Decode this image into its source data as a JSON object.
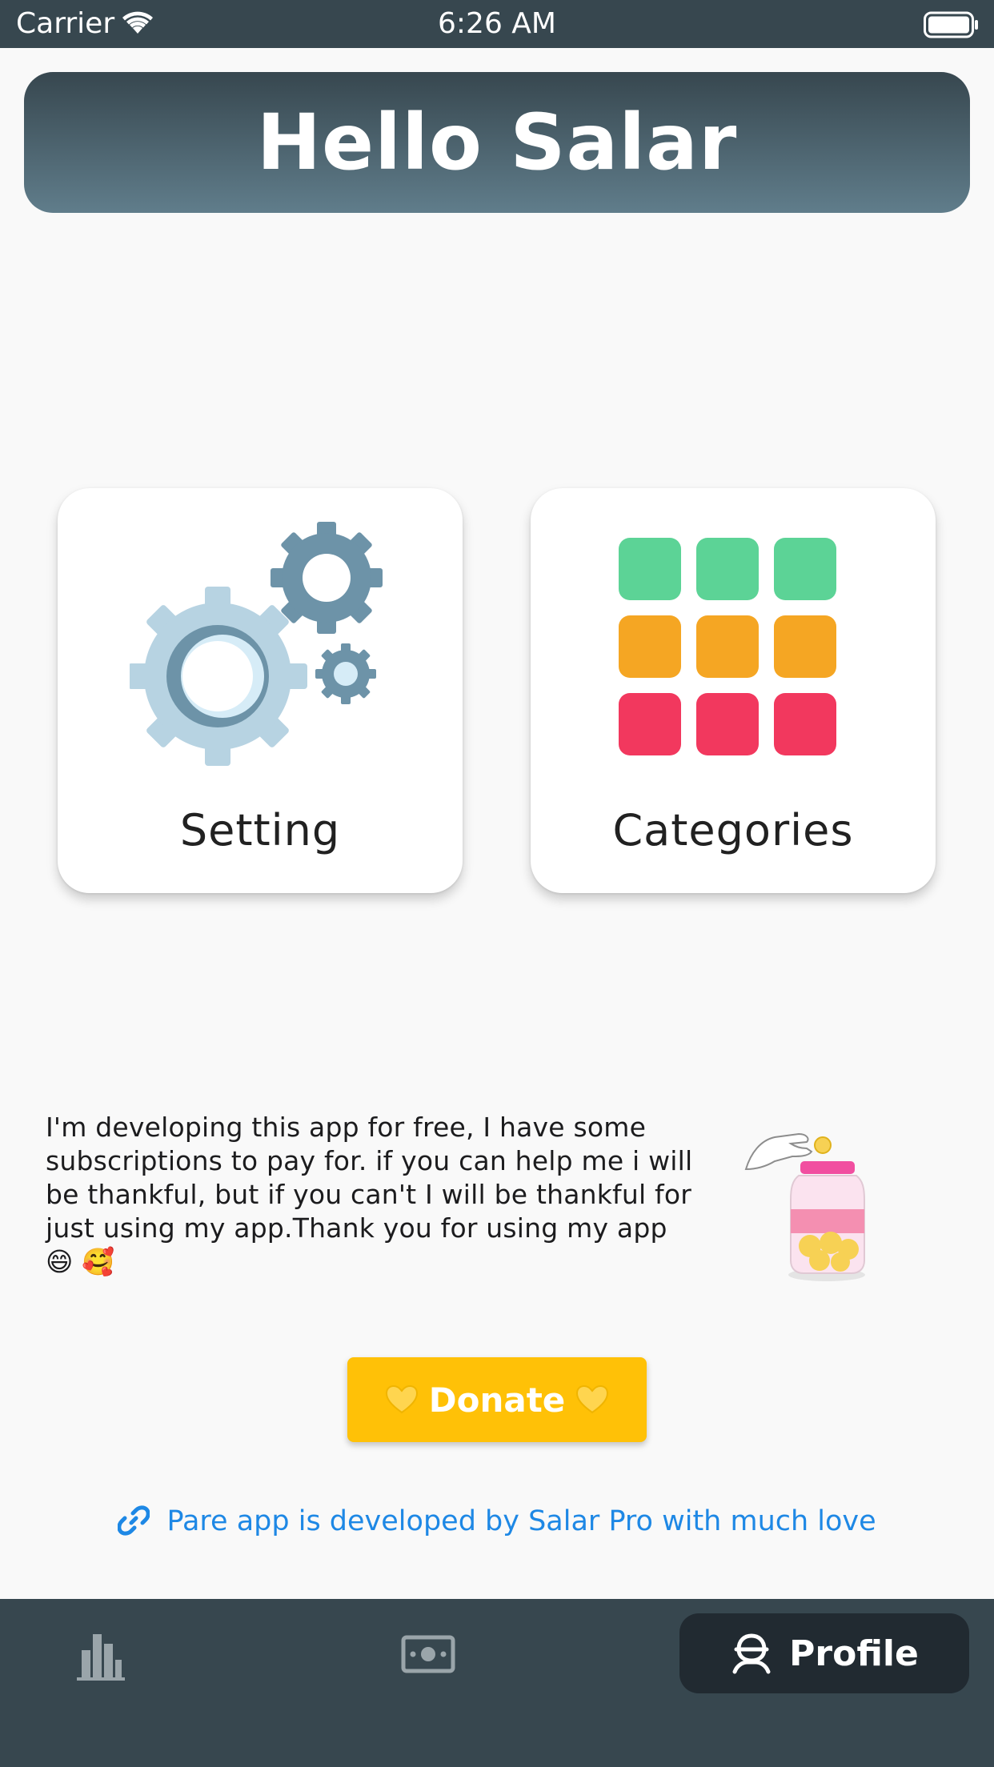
{
  "status_bar": {
    "carrier": "Carrier",
    "time": "6:26 AM"
  },
  "header": {
    "title": "Hello Salar"
  },
  "cards": {
    "setting_label": "Setting",
    "categories_label": "Categories"
  },
  "donation": {
    "message": "I'm developing this app for free, I have some subscriptions to pay for. if you can help me i will be thankful, but if you can't I will be thankful for just using my app.Thank you for using my app 😄 🥰",
    "button_label": "Donate"
  },
  "footer": {
    "credit": "Pare app is developed by Salar Pro with much love"
  },
  "bottom_nav": {
    "items": [
      {
        "icon": "bar-chart-icon",
        "label": ""
      },
      {
        "icon": "money-icon",
        "label": ""
      },
      {
        "icon": "profile-icon",
        "label": "Profile"
      }
    ],
    "active_index": 2
  },
  "colors": {
    "header_gradient_top": "#37474f",
    "header_gradient_bottom": "#607d8b",
    "donate_button": "#ffc107",
    "link": "#1e88e5",
    "nav_background": "#37474f",
    "nav_active": "#212a31",
    "grid_green": "#5cd396",
    "grid_orange": "#f5a623",
    "grid_red": "#f2385e"
  }
}
